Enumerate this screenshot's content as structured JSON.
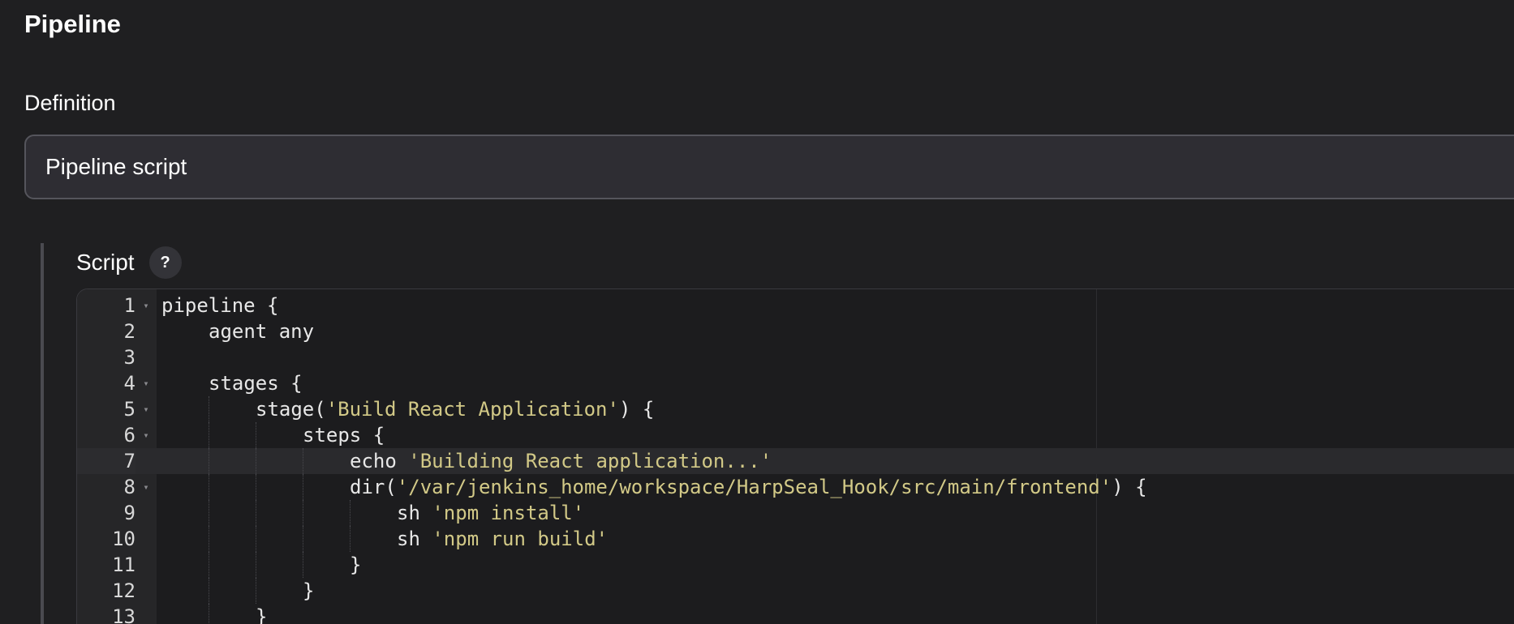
{
  "section": {
    "title": "Pipeline"
  },
  "definition": {
    "label": "Definition",
    "selected": "Pipeline script"
  },
  "script": {
    "label": "Script",
    "help_label": "?",
    "active_line": 7,
    "lines": [
      {
        "num": "1",
        "fold": true,
        "indent": 0,
        "parts": [
          {
            "t": "pipeline {",
            "k": "plain"
          }
        ]
      },
      {
        "num": "2",
        "fold": false,
        "indent": 1,
        "parts": [
          {
            "t": "agent any",
            "k": "plain"
          }
        ]
      },
      {
        "num": "3",
        "fold": false,
        "indent": 0,
        "parts": []
      },
      {
        "num": "4",
        "fold": true,
        "indent": 1,
        "parts": [
          {
            "t": "stages {",
            "k": "plain"
          }
        ]
      },
      {
        "num": "5",
        "fold": true,
        "indent": 2,
        "parts": [
          {
            "t": "stage(",
            "k": "plain"
          },
          {
            "t": "'Build React Application'",
            "k": "str"
          },
          {
            "t": ") {",
            "k": "plain"
          }
        ]
      },
      {
        "num": "6",
        "fold": true,
        "indent": 3,
        "parts": [
          {
            "t": "steps {",
            "k": "plain"
          }
        ]
      },
      {
        "num": "7",
        "fold": false,
        "indent": 4,
        "parts": [
          {
            "t": "echo ",
            "k": "plain"
          },
          {
            "t": "'Building React application...'",
            "k": "str"
          }
        ]
      },
      {
        "num": "8",
        "fold": true,
        "indent": 4,
        "parts": [
          {
            "t": "dir(",
            "k": "plain"
          },
          {
            "t": "'/var/jenkins_home/workspace/HarpSeal_Hook/src/main/frontend'",
            "k": "str"
          },
          {
            "t": ") {",
            "k": "plain"
          }
        ]
      },
      {
        "num": "9",
        "fold": false,
        "indent": 5,
        "parts": [
          {
            "t": "sh ",
            "k": "plain"
          },
          {
            "t": "'npm install'",
            "k": "str"
          }
        ]
      },
      {
        "num": "10",
        "fold": false,
        "indent": 5,
        "parts": [
          {
            "t": "sh ",
            "k": "plain"
          },
          {
            "t": "'npm run build'",
            "k": "str"
          }
        ]
      },
      {
        "num": "11",
        "fold": false,
        "indent": 4,
        "parts": [
          {
            "t": "}",
            "k": "plain"
          }
        ]
      },
      {
        "num": "12",
        "fold": false,
        "indent": 3,
        "parts": [
          {
            "t": "}",
            "k": "plain"
          }
        ]
      },
      {
        "num": "13",
        "fold": false,
        "indent": 2,
        "parts": [
          {
            "t": "}",
            "k": "plain"
          }
        ]
      }
    ]
  },
  "icons": {
    "fold": "fold-arrow-icon"
  }
}
